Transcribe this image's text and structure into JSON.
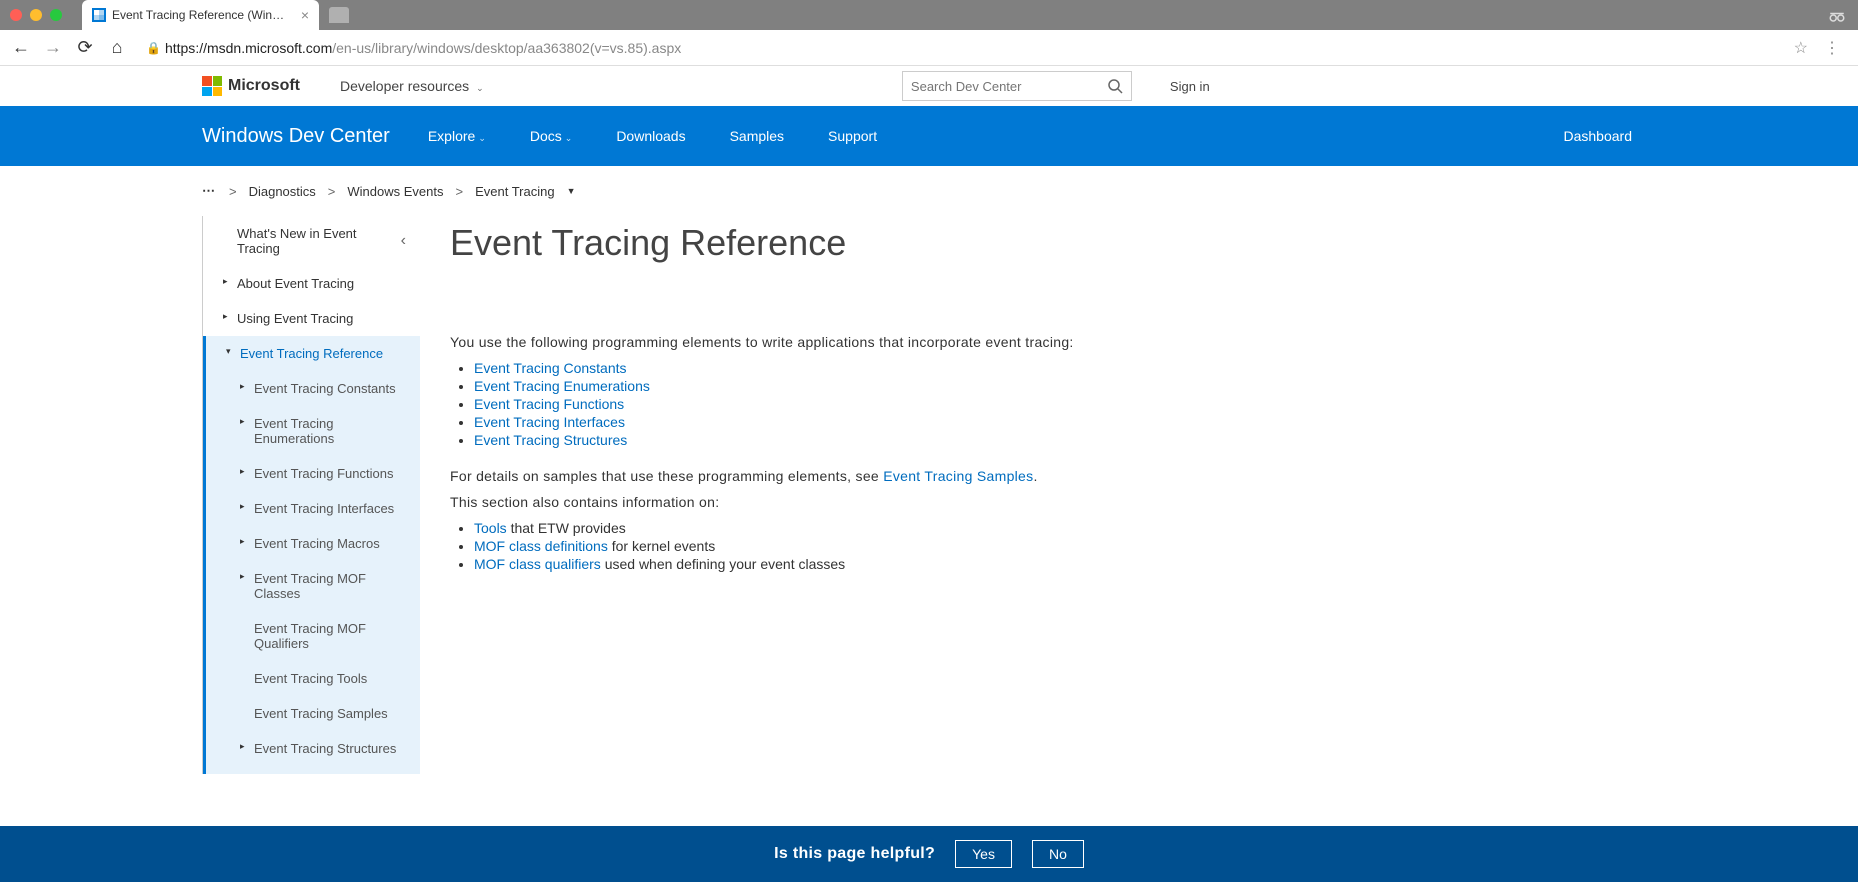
{
  "browser": {
    "tab_title": "Event Tracing Reference (Win…",
    "url_scheme": "https",
    "url_domain": "://msdn.microsoft.com",
    "url_path": "/en-us/library/windows/desktop/aa363802(v=vs.85).aspx"
  },
  "ms_header": {
    "brand": "Microsoft",
    "dev_resources": "Developer resources",
    "search_placeholder": "Search Dev Center",
    "signin": "Sign in"
  },
  "blue_nav": {
    "title": "Windows Dev Center",
    "items": [
      "Explore",
      "Docs",
      "Downloads",
      "Samples",
      "Support"
    ],
    "dashboard": "Dashboard"
  },
  "breadcrumb": {
    "items": [
      "Diagnostics",
      "Windows Events",
      "Event Tracing"
    ]
  },
  "sidebar": {
    "top": "What's New in Event Tracing",
    "items": [
      "About Event Tracing",
      "Using Event Tracing"
    ],
    "active": "Event Tracing Reference",
    "children": [
      "Event Tracing Constants",
      "Event Tracing Enumerations",
      "Event Tracing Functions",
      "Event Tracing Interfaces",
      "Event Tracing Macros",
      "Event Tracing MOF Classes"
    ],
    "grandchildren": [
      "Event Tracing MOF Qualifiers",
      "Event Tracing Tools",
      "Event Tracing Samples"
    ],
    "last_child": "Event Tracing Structures"
  },
  "content": {
    "title": "Event Tracing Reference",
    "intro": "You use the following programming elements to write applications that incorporate event tracing:",
    "links": [
      "Event Tracing Constants",
      "Event Tracing Enumerations",
      "Event Tracing Functions",
      "Event Tracing Interfaces",
      "Event Tracing Structures"
    ],
    "para2_a": "For details on samples that use these programming elements, see ",
    "para2_link": "Event Tracing Samples",
    "para2_b": ".",
    "para3": "This section also contains information on:",
    "list2": [
      {
        "link": "Tools",
        "text": " that ETW provides"
      },
      {
        "link": "MOF class definitions",
        "text": " for kernel events"
      },
      {
        "link": "MOF class qualifiers",
        "text": " used when defining your event classes"
      }
    ]
  },
  "feedback": {
    "q": "Is this page helpful?",
    "yes": "Yes",
    "no": "No"
  }
}
